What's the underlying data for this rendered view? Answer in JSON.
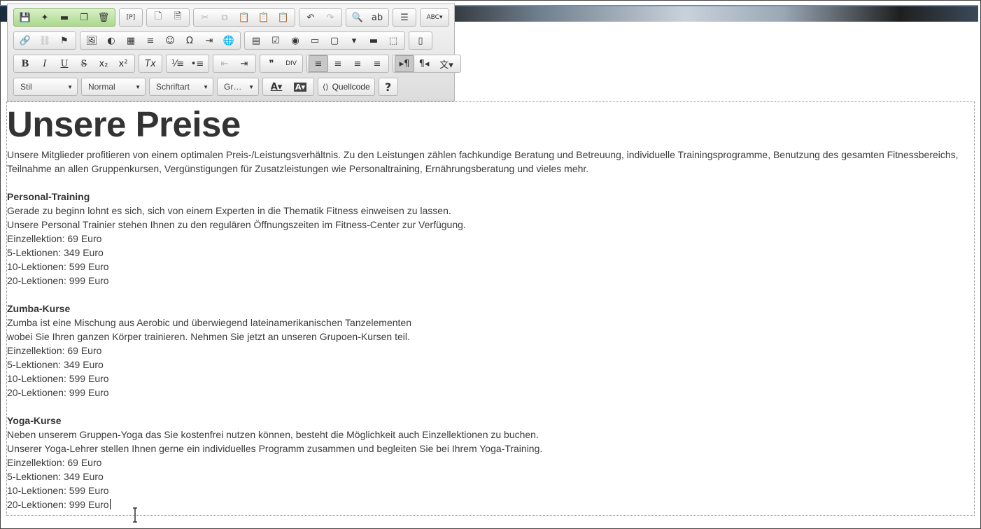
{
  "toolbar": {
    "row1": [
      {
        "group": "document",
        "green": true,
        "buttons": [
          {
            "icon": "save-icon",
            "glyph": "💾"
          },
          {
            "icon": "magic-wand-icon",
            "glyph": "✦"
          },
          {
            "icon": "folder-icon",
            "glyph": "▬"
          },
          {
            "icon": "copy-icon",
            "glyph": "❐"
          },
          {
            "icon": "trash-icon",
            "glyph": "🗑"
          }
        ]
      },
      {
        "group": "placeholder",
        "buttons": [
          {
            "icon": "placeholder-icon",
            "glyph": "[P]"
          }
        ]
      },
      {
        "group": "templates",
        "buttons": [
          {
            "icon": "new-page-icon",
            "glyph": "🗋"
          },
          {
            "icon": "preview-icon",
            "glyph": "🗎"
          }
        ]
      },
      {
        "group": "clipboard",
        "buttons": [
          {
            "icon": "cut-icon",
            "glyph": "✂",
            "dim": true
          },
          {
            "icon": "copy-icon",
            "glyph": "⧉",
            "dim": true
          },
          {
            "icon": "paste-icon",
            "glyph": "📋"
          },
          {
            "icon": "paste-text-icon",
            "glyph": "📋"
          },
          {
            "icon": "paste-word-icon",
            "glyph": "📋"
          }
        ]
      },
      {
        "group": "undo",
        "buttons": [
          {
            "icon": "undo-icon",
            "glyph": "↶"
          },
          {
            "icon": "redo-icon",
            "glyph": "↷",
            "dim": true
          }
        ]
      },
      {
        "group": "find",
        "buttons": [
          {
            "icon": "find-icon",
            "glyph": "🔍"
          },
          {
            "icon": "replace-icon",
            "glyph": "ab"
          }
        ]
      },
      {
        "group": "select",
        "buttons": [
          {
            "icon": "select-all-icon",
            "glyph": "☰"
          }
        ]
      },
      {
        "group": "spell",
        "buttons": [
          {
            "icon": "spellcheck-icon",
            "glyph": "ABC▾",
            "wide": true
          }
        ]
      }
    ],
    "row2": [
      {
        "group": "links",
        "buttons": [
          {
            "icon": "link-icon",
            "glyph": "🔗"
          },
          {
            "icon": "unlink-icon",
            "glyph": "⛓",
            "dim": true
          },
          {
            "icon": "anchor-flag-icon",
            "glyph": "⚑"
          }
        ]
      },
      {
        "group": "insert",
        "buttons": [
          {
            "icon": "image-icon",
            "glyph": "🖼"
          },
          {
            "icon": "flash-icon",
            "glyph": "◐"
          },
          {
            "icon": "table-icon",
            "glyph": "▦"
          },
          {
            "icon": "horizontal-line-icon",
            "glyph": "≡"
          },
          {
            "icon": "smiley-icon",
            "glyph": "☺"
          },
          {
            "icon": "special-char-icon",
            "glyph": "Ω"
          },
          {
            "icon": "page-break-icon",
            "glyph": "⇥"
          },
          {
            "icon": "iframe-icon",
            "glyph": "🌐"
          }
        ]
      },
      {
        "group": "forms",
        "buttons": [
          {
            "icon": "form-icon",
            "glyph": "▤"
          },
          {
            "icon": "checkbox-icon",
            "glyph": "☑"
          },
          {
            "icon": "radio-icon",
            "glyph": "◉"
          },
          {
            "icon": "textfield-icon",
            "glyph": "▭"
          },
          {
            "icon": "textarea-icon",
            "glyph": "▢"
          },
          {
            "icon": "select-field-icon",
            "glyph": "▾"
          },
          {
            "icon": "button-field-icon",
            "glyph": "▬"
          },
          {
            "icon": "hidden-field-icon",
            "glyph": "⬚"
          }
        ]
      },
      {
        "group": "maximize",
        "buttons": [
          {
            "icon": "maximize-icon",
            "glyph": "▯"
          }
        ]
      }
    ],
    "row3": [
      {
        "group": "basic",
        "buttons": [
          {
            "icon": "bold-icon",
            "glyph": "B"
          },
          {
            "icon": "italic-icon",
            "glyph": "I"
          },
          {
            "icon": "underline-icon",
            "glyph": "U"
          },
          {
            "icon": "strike-icon",
            "glyph": "S"
          },
          {
            "icon": "subscript-icon",
            "glyph": "x₂"
          },
          {
            "icon": "superscript-icon",
            "glyph": "x²"
          }
        ]
      },
      {
        "group": "clear",
        "buttons": [
          {
            "icon": "remove-format-icon",
            "glyph": "Tx"
          }
        ]
      },
      {
        "group": "lists",
        "buttons": [
          {
            "icon": "numbered-list-icon",
            "glyph": "⅟≡"
          },
          {
            "icon": "bullet-list-icon",
            "glyph": "•≡"
          }
        ]
      },
      {
        "group": "indent",
        "buttons": [
          {
            "icon": "outdent-icon",
            "glyph": "⇤",
            "dim": true
          },
          {
            "icon": "indent-icon",
            "glyph": "⇥"
          }
        ]
      },
      {
        "group": "blocks",
        "buttons": [
          {
            "icon": "blockquote-icon",
            "glyph": "❞"
          },
          {
            "icon": "div-container-icon",
            "glyph": "DIV"
          }
        ]
      },
      {
        "group": "align",
        "buttons": [
          {
            "icon": "align-left-icon",
            "glyph": "≡",
            "on": true
          },
          {
            "icon": "align-center-icon",
            "glyph": "≡"
          },
          {
            "icon": "align-right-icon",
            "glyph": "≡"
          },
          {
            "icon": "align-justify-icon",
            "glyph": "≡"
          }
        ]
      },
      {
        "group": "bidi",
        "buttons": [
          {
            "icon": "ltr-icon",
            "glyph": "▸¶",
            "on": true
          },
          {
            "icon": "rtl-icon",
            "glyph": "¶◂"
          },
          {
            "icon": "language-icon",
            "glyph": "文▾",
            "wide": true
          }
        ]
      }
    ],
    "row4": {
      "combos": [
        {
          "name": "styles-combo",
          "label": "Stil",
          "width": 92
        },
        {
          "name": "format-combo",
          "label": "Normal",
          "width": 92
        },
        {
          "name": "font-combo",
          "label": "Schriftart",
          "width": 92
        },
        {
          "name": "size-combo",
          "label": "Gr…",
          "width": 60
        }
      ],
      "color_buttons": [
        {
          "icon": "text-color-icon",
          "glyph": "A▾"
        },
        {
          "icon": "bg-color-icon",
          "glyph": "A▾"
        }
      ],
      "source_label": "Quellcode",
      "help_label": "?"
    }
  },
  "content": {
    "title": "Unsere Preise",
    "intro": "Unsere Mitglieder profitieren von einem optimalen Preis-/Leistungsverhältnis. Zu den Leistungen zählen fachkundige Beratung und Betreuung, individuelle Trainingsprogramme, Benutzung des gesamten Fitnessbereichs, Teilnahme an allen Gruppenkursen, Vergünstigungen für Zusatzleistungen wie Personaltraining, Ernährungsberatung und vieles mehr.",
    "sections": [
      {
        "heading": "Personal-Training",
        "lines": [
          "Gerade zu beginn lohnt es sich, sich von einem Experten in die Thematik Fitness einweisen zu lassen.",
          "Unsere Personal Trainier stehen Ihnen zu den regulären Öffnungszeiten im Fitness-Center zur Verfügung.",
          "Einzellektion: 69 Euro",
          "5-Lektionen: 349 Euro",
          "10-Lektionen: 599 Euro",
          "20-Lektionen: 999 Euro"
        ]
      },
      {
        "heading": "Zumba-Kurse",
        "lines": [
          "Zumba ist eine Mischung aus Aerobic und überwiegend lateinamerikanischen Tanzelementen",
          "wobei Sie Ihren ganzen Körper trainieren. Nehmen Sie jetzt an unseren Grupoen-Kursen teil.",
          "Einzellektion: 69 Euro",
          "5-Lektionen: 349 Euro",
          "10-Lektionen: 599 Euro",
          "20-Lektionen: 999 Euro"
        ]
      },
      {
        "heading": "Yoga-Kurse",
        "lines": [
          "Neben unserem Gruppen-Yoga das Sie kostenfrei nutzen können, besteht die Möglichkeit auch Einzellektionen zu buchen.",
          "Unserer Yoga-Lehrer stellen Ihnen gerne ein individuelles Programm zusammen und begleiten Sie bei Ihrem Yoga-Training.",
          "Einzellektion: 69 Euro",
          "5-Lektionen: 349 Euro",
          "10-Lektionen: 599 Euro",
          "20-Lektionen: 999 Euro"
        ]
      }
    ]
  }
}
